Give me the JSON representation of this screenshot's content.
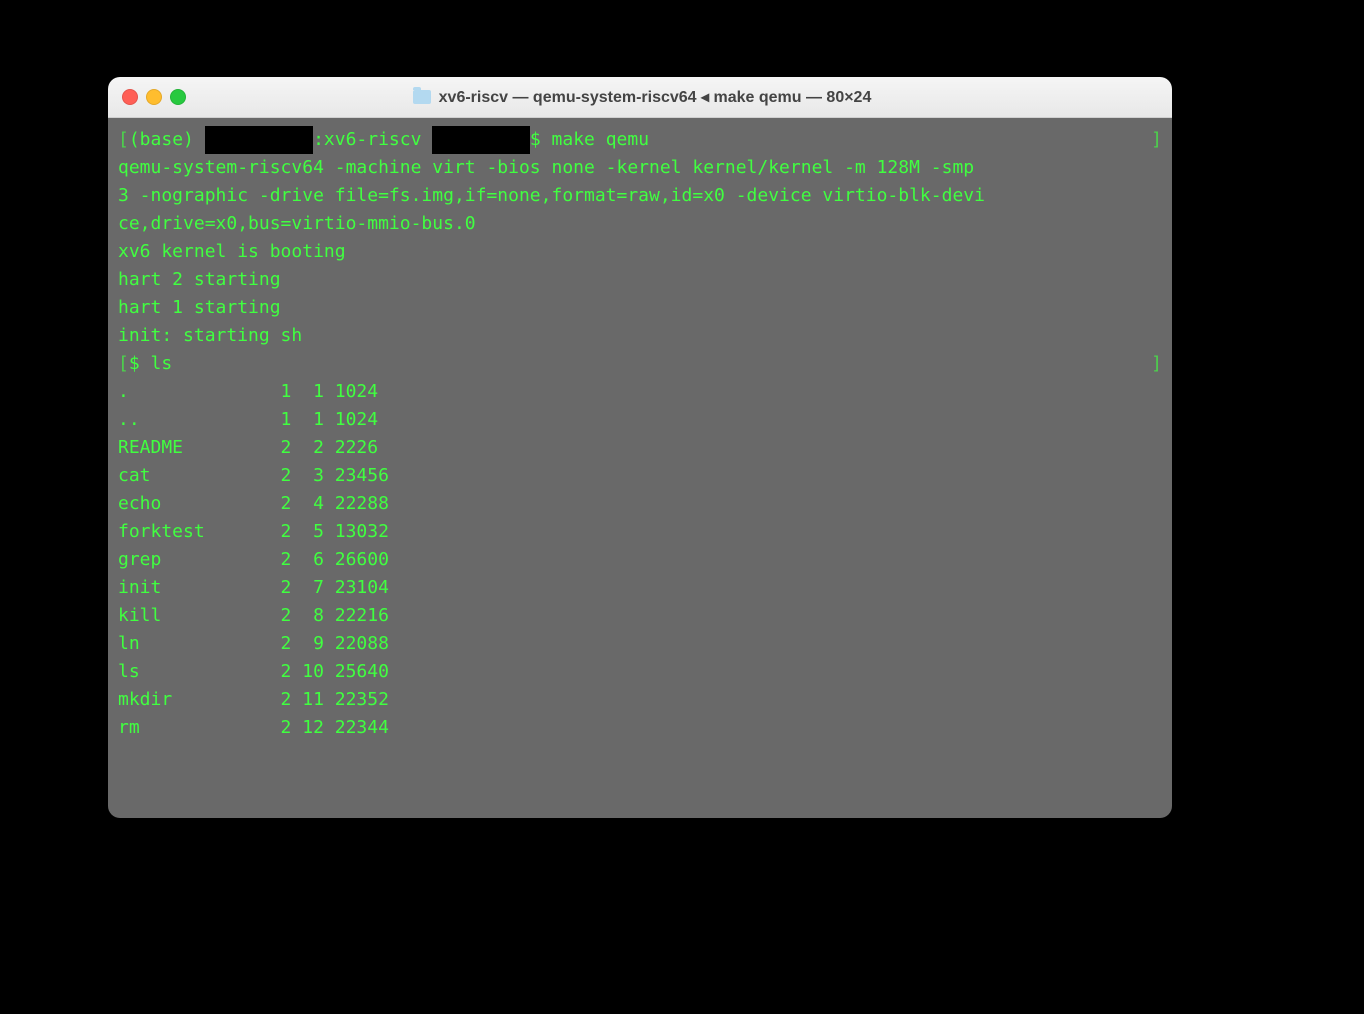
{
  "window": {
    "title": "xv6-riscv — qemu-system-riscv64 ◂ make qemu — 80×24"
  },
  "prompt": {
    "prefix": "(base) ",
    "redacted1": "          ",
    "dir": ":xv6-riscv ",
    "redacted2": "         ",
    "symbol": "$ ",
    "command1": "make qemu"
  },
  "output": {
    "qemu_line1": "qemu-system-riscv64 -machine virt -bios none -kernel kernel/kernel -m 128M -smp ",
    "qemu_line2": "3 -nographic -drive file=fs.img,if=none,format=raw,id=x0 -device virtio-blk-devi",
    "qemu_line3": "ce,drive=x0,bus=virtio-mmio-bus.0",
    "blank1": "",
    "boot": "xv6 kernel is booting",
    "blank2": "",
    "hart2": "hart 2 starting",
    "hart1": "hart 1 starting",
    "init": "init: starting sh",
    "shell_prompt": "$ ",
    "shell_cmd": "ls"
  },
  "ls": [
    {
      "name": ".",
      "type": "1",
      "ino": "1",
      "size": "1024"
    },
    {
      "name": "..",
      "type": "1",
      "ino": "1",
      "size": "1024"
    },
    {
      "name": "README",
      "type": "2",
      "ino": "2",
      "size": "2226"
    },
    {
      "name": "cat",
      "type": "2",
      "ino": "3",
      "size": "23456"
    },
    {
      "name": "echo",
      "type": "2",
      "ino": "4",
      "size": "22288"
    },
    {
      "name": "forktest",
      "type": "2",
      "ino": "5",
      "size": "13032"
    },
    {
      "name": "grep",
      "type": "2",
      "ino": "6",
      "size": "26600"
    },
    {
      "name": "init",
      "type": "2",
      "ino": "7",
      "size": "23104"
    },
    {
      "name": "kill",
      "type": "2",
      "ino": "8",
      "size": "22216"
    },
    {
      "name": "ln",
      "type": "2",
      "ino": "9",
      "size": "22088"
    },
    {
      "name": "ls",
      "type": "2",
      "ino": "10",
      "size": "25640"
    },
    {
      "name": "mkdir",
      "type": "2",
      "ino": "11",
      "size": "22352"
    },
    {
      "name": "rm",
      "type": "2",
      "ino": "12",
      "size": "22344"
    }
  ]
}
